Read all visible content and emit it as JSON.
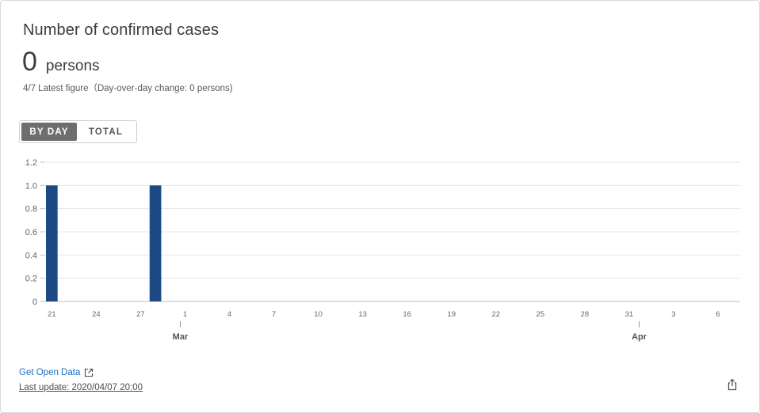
{
  "card": {
    "title": "Number of confirmed cases",
    "value": "0",
    "unit": "persons",
    "subline": "4/7 Latest figure（Day-over-day change: 0 persons)"
  },
  "toggle": {
    "by_day_label": "BY DAY",
    "total_label": "TOTAL",
    "selected": "BY DAY"
  },
  "chart_data": {
    "type": "bar",
    "categories": [
      "21",
      "22",
      "23",
      "24",
      "25",
      "26",
      "27",
      "28",
      "29",
      "1",
      "2",
      "3",
      "4",
      "5",
      "6",
      "7",
      "8",
      "9",
      "10",
      "11",
      "12",
      "13",
      "14",
      "15",
      "16",
      "17",
      "18",
      "19",
      "20",
      "21",
      "22",
      "23",
      "24",
      "25",
      "26",
      "27",
      "28",
      "29",
      "30",
      "31",
      "1",
      "2",
      "3",
      "4",
      "5",
      "6",
      "7"
    ],
    "values": [
      1,
      0,
      0,
      0,
      0,
      0,
      0,
      1,
      0,
      0,
      0,
      0,
      0,
      0,
      0,
      0,
      0,
      0,
      0,
      0,
      0,
      0,
      0,
      0,
      0,
      0,
      0,
      0,
      0,
      0,
      0,
      0,
      0,
      0,
      0,
      0,
      0,
      0,
      0,
      0,
      0,
      0,
      0,
      0,
      0,
      0,
      0
    ],
    "x_tick_labels": [
      "21",
      "24",
      "27",
      "1",
      "4",
      "7",
      "10",
      "13",
      "16",
      "19",
      "22",
      "25",
      "28",
      "31",
      "3",
      "6"
    ],
    "month_labels": [
      {
        "label": "Mar",
        "category_index": 9
      },
      {
        "label": "Apr",
        "category_index": 40
      }
    ],
    "y_tick_labels": [
      "0",
      "0.2",
      "0.4",
      "0.6",
      "0.8",
      "1.0",
      "1.2"
    ],
    "ylim": [
      0,
      1.2
    ],
    "grid": true,
    "bar_color": "#1d4a87",
    "title": "",
    "xlabel": "",
    "ylabel": ""
  },
  "footer": {
    "open_data_label": "Get Open Data",
    "last_update": "Last update: 2020/04/07 20:00"
  },
  "colors": {
    "accent": "#1a6fc4",
    "bar": "#1d4a87",
    "toggle_active": "#6e6e6e"
  },
  "icons": {
    "external": "external-link-icon",
    "share": "share-icon"
  }
}
